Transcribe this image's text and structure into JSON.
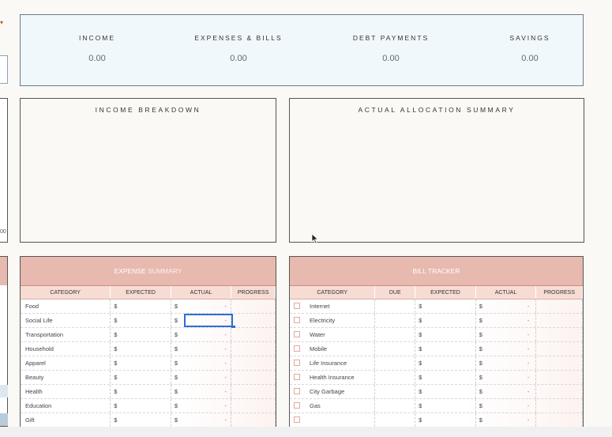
{
  "summary": {
    "income_label": "INCOME",
    "income_value": "0.00",
    "expenses_label": "EXPENSES & BILLS",
    "expenses_value": "0.00",
    "debt_label": "DEBT PAYMENTS",
    "debt_value": "0.00",
    "savings_label": "SAVINGS",
    "savings_value": "0.00"
  },
  "left_edge": {
    "value": "00"
  },
  "charts": {
    "income_breakdown_title": "INCOME BREAKDOWN",
    "allocation_title": "ACTUAL ALLOCATION SUMMARY"
  },
  "expense_summary": {
    "title_a": "EXPENSE",
    "title_b": " SUMMARY",
    "columns": [
      "CATEGORY",
      "EXPECTED",
      "ACTUAL",
      "PROGRESS"
    ],
    "rows": [
      {
        "category": "Food",
        "expected": "$",
        "actual": "$",
        "dash": "-"
      },
      {
        "category": "Social Life",
        "expected": "$",
        "actual": "$",
        "dash": "-"
      },
      {
        "category": "Transportation",
        "expected": "$",
        "actual": "$",
        "dash": "-"
      },
      {
        "category": "Household",
        "expected": "$",
        "actual": "$",
        "dash": "-"
      },
      {
        "category": "Apparel",
        "expected": "$",
        "actual": "$",
        "dash": "-"
      },
      {
        "category": "Beauty",
        "expected": "$",
        "actual": "$",
        "dash": "-"
      },
      {
        "category": "Health",
        "expected": "$",
        "actual": "$",
        "dash": "-"
      },
      {
        "category": "Education",
        "expected": "$",
        "actual": "$",
        "dash": "-"
      },
      {
        "category": "Gift",
        "expected": "$",
        "actual": "$",
        "dash": "-"
      }
    ]
  },
  "bill_tracker": {
    "title": "BILL TRACKER",
    "columns": [
      "CATEGORY",
      "DUE",
      "EXPECTED",
      "ACTUAL",
      "PROGRESS"
    ],
    "rows": [
      {
        "category": "Internet",
        "expected": "$",
        "actual": "$",
        "dash": "-"
      },
      {
        "category": "Electricity",
        "expected": "$",
        "actual": "$",
        "dash": "-"
      },
      {
        "category": "Water",
        "expected": "$",
        "actual": "$",
        "dash": "-"
      },
      {
        "category": "Mobile",
        "expected": "$",
        "actual": "$",
        "dash": "-"
      },
      {
        "category": "Life Insurance",
        "expected": "$",
        "actual": "$",
        "dash": "-"
      },
      {
        "category": "Health Insurance",
        "expected": "$",
        "actual": "$",
        "dash": "-"
      },
      {
        "category": "City Garbage",
        "expected": "$",
        "actual": "$",
        "dash": "-"
      },
      {
        "category": "Gas",
        "expected": "$",
        "actual": "$",
        "dash": "-"
      },
      {
        "category": "",
        "expected": "$",
        "actual": "$",
        "dash": "-"
      }
    ]
  },
  "colors": {
    "header_pink": "#e8b9ae",
    "subheader_pink": "#f7dcd4",
    "summary_bg": "#f0f8fc",
    "selection_blue": "#2b6fd6"
  }
}
